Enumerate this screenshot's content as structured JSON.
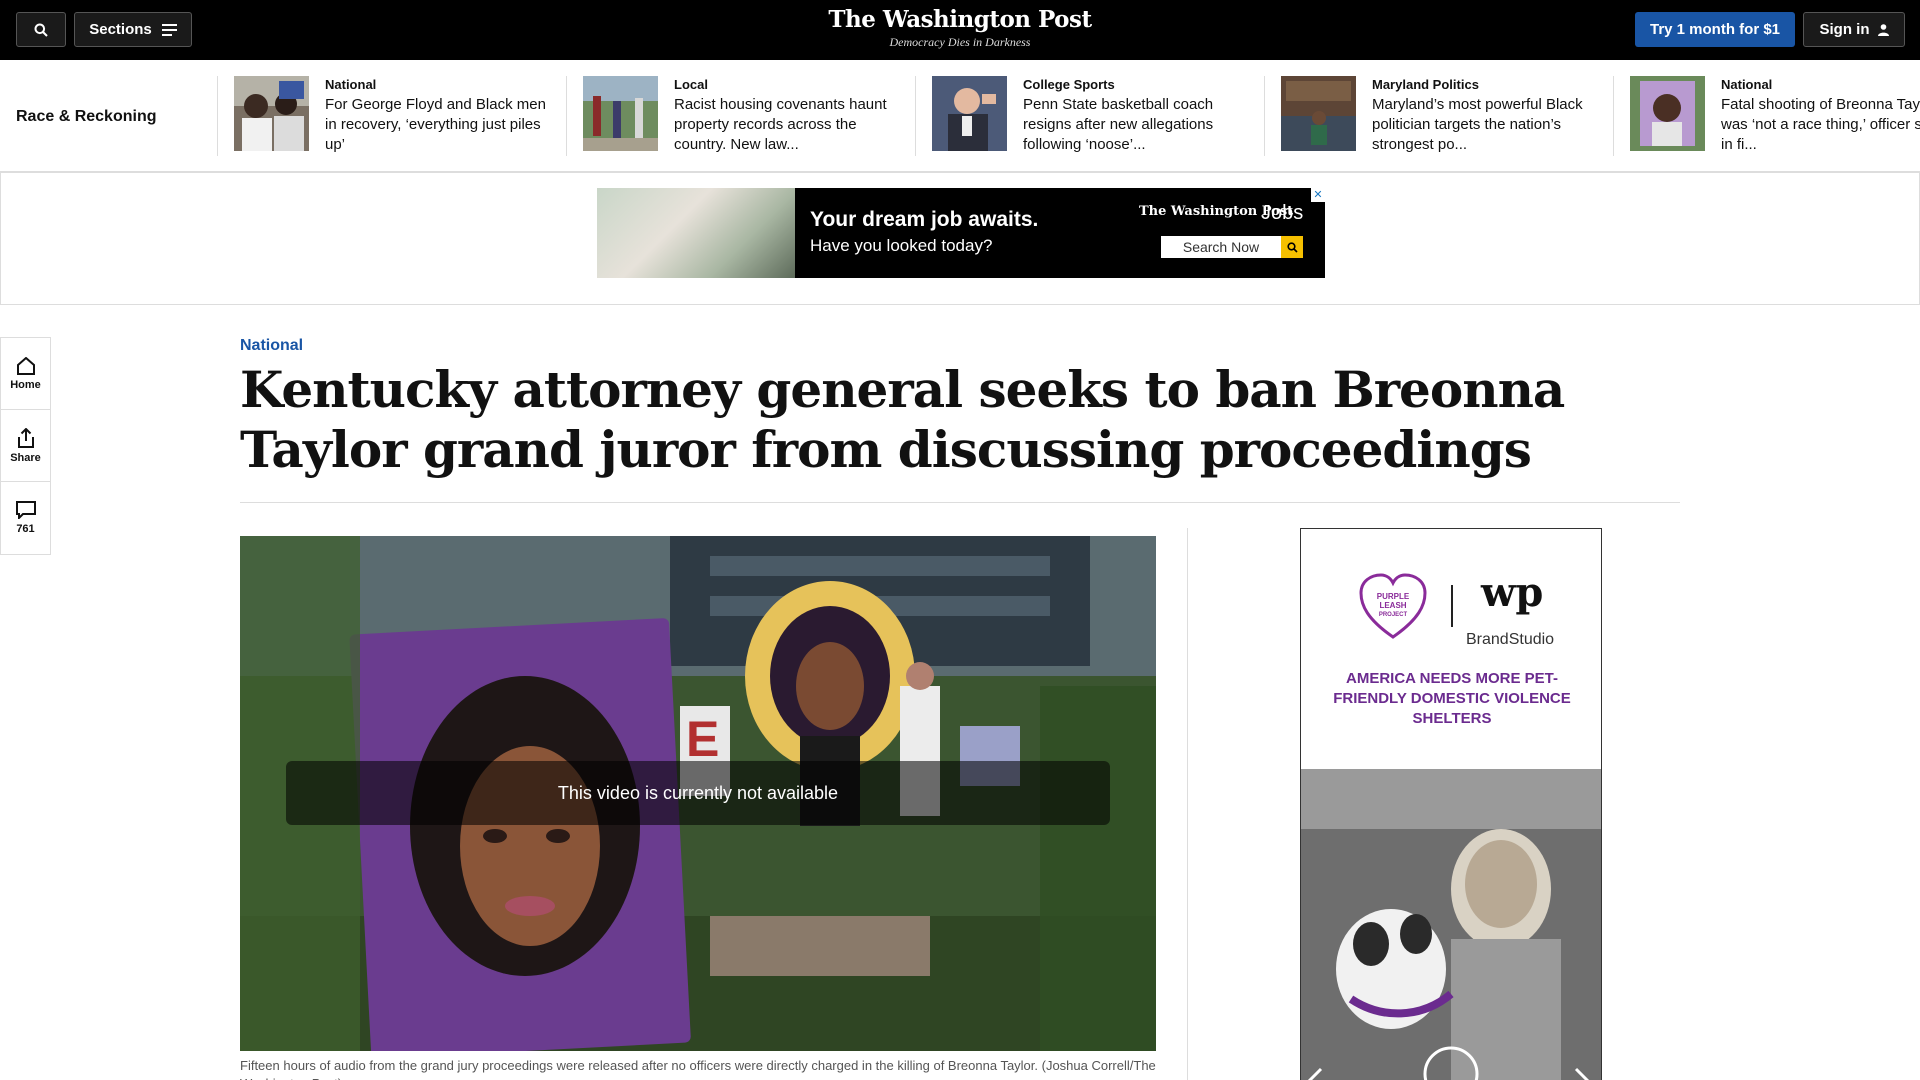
{
  "topbar": {
    "sections_label": "Sections",
    "logo_name": "The Washington Post",
    "logo_tagline": "Democracy Dies in Darkness",
    "try_label": "Try 1 month for $1",
    "signin_label": "Sign in"
  },
  "strip": {
    "title": "Race & Reckoning",
    "items": [
      {
        "kicker": "National",
        "headline": "For George Floyd and Black men in recovery, ‘everything just piles up’"
      },
      {
        "kicker": "Local",
        "headline": "Racist housing covenants haunt property records across the country. New law..."
      },
      {
        "kicker": "College Sports",
        "headline": "Penn State basketball coach resigns after new allegations following ‘noose’..."
      },
      {
        "kicker": "Maryland Politics",
        "headline": "Maryland’s most powerful Black politician targets the nation’s strongest po..."
      },
      {
        "kicker": "National",
        "headline": "Fatal shooting of Breonna Taylor was ‘not a race thing,’ officer says in fi..."
      }
    ]
  },
  "ad_banner": {
    "headline": "Your dream job awaits.",
    "subline": "Have you looked today?",
    "brand": "The Washington Post",
    "jobs": "Jobs",
    "search_label": "Search Now"
  },
  "rail": {
    "home": "Home",
    "share": "Share",
    "comments": "761"
  },
  "article": {
    "kicker": "National",
    "headline": "Kentucky attorney general seeks to ban Breonna Taylor grand juror from discussing proceedings",
    "video_message": "This video is currently not available",
    "caption": "Fifteen hours of audio from the grand jury proceedings were released after no officers were directly charged in the killing of Breonna Taylor. (Joshua Correll/The Washington Post)"
  },
  "side_ad": {
    "heart_text": "PURPLE LEASH PROJECT",
    "wp_logo": "wp",
    "brandstudio": "BrandStudio",
    "text": "AMERICA NEEDS MORE PET-FRIENDLY DOMESTIC VIOLENCE SHELTERS"
  },
  "colors": {
    "accent": "#1955a5",
    "purple": "#6b2b8f"
  }
}
